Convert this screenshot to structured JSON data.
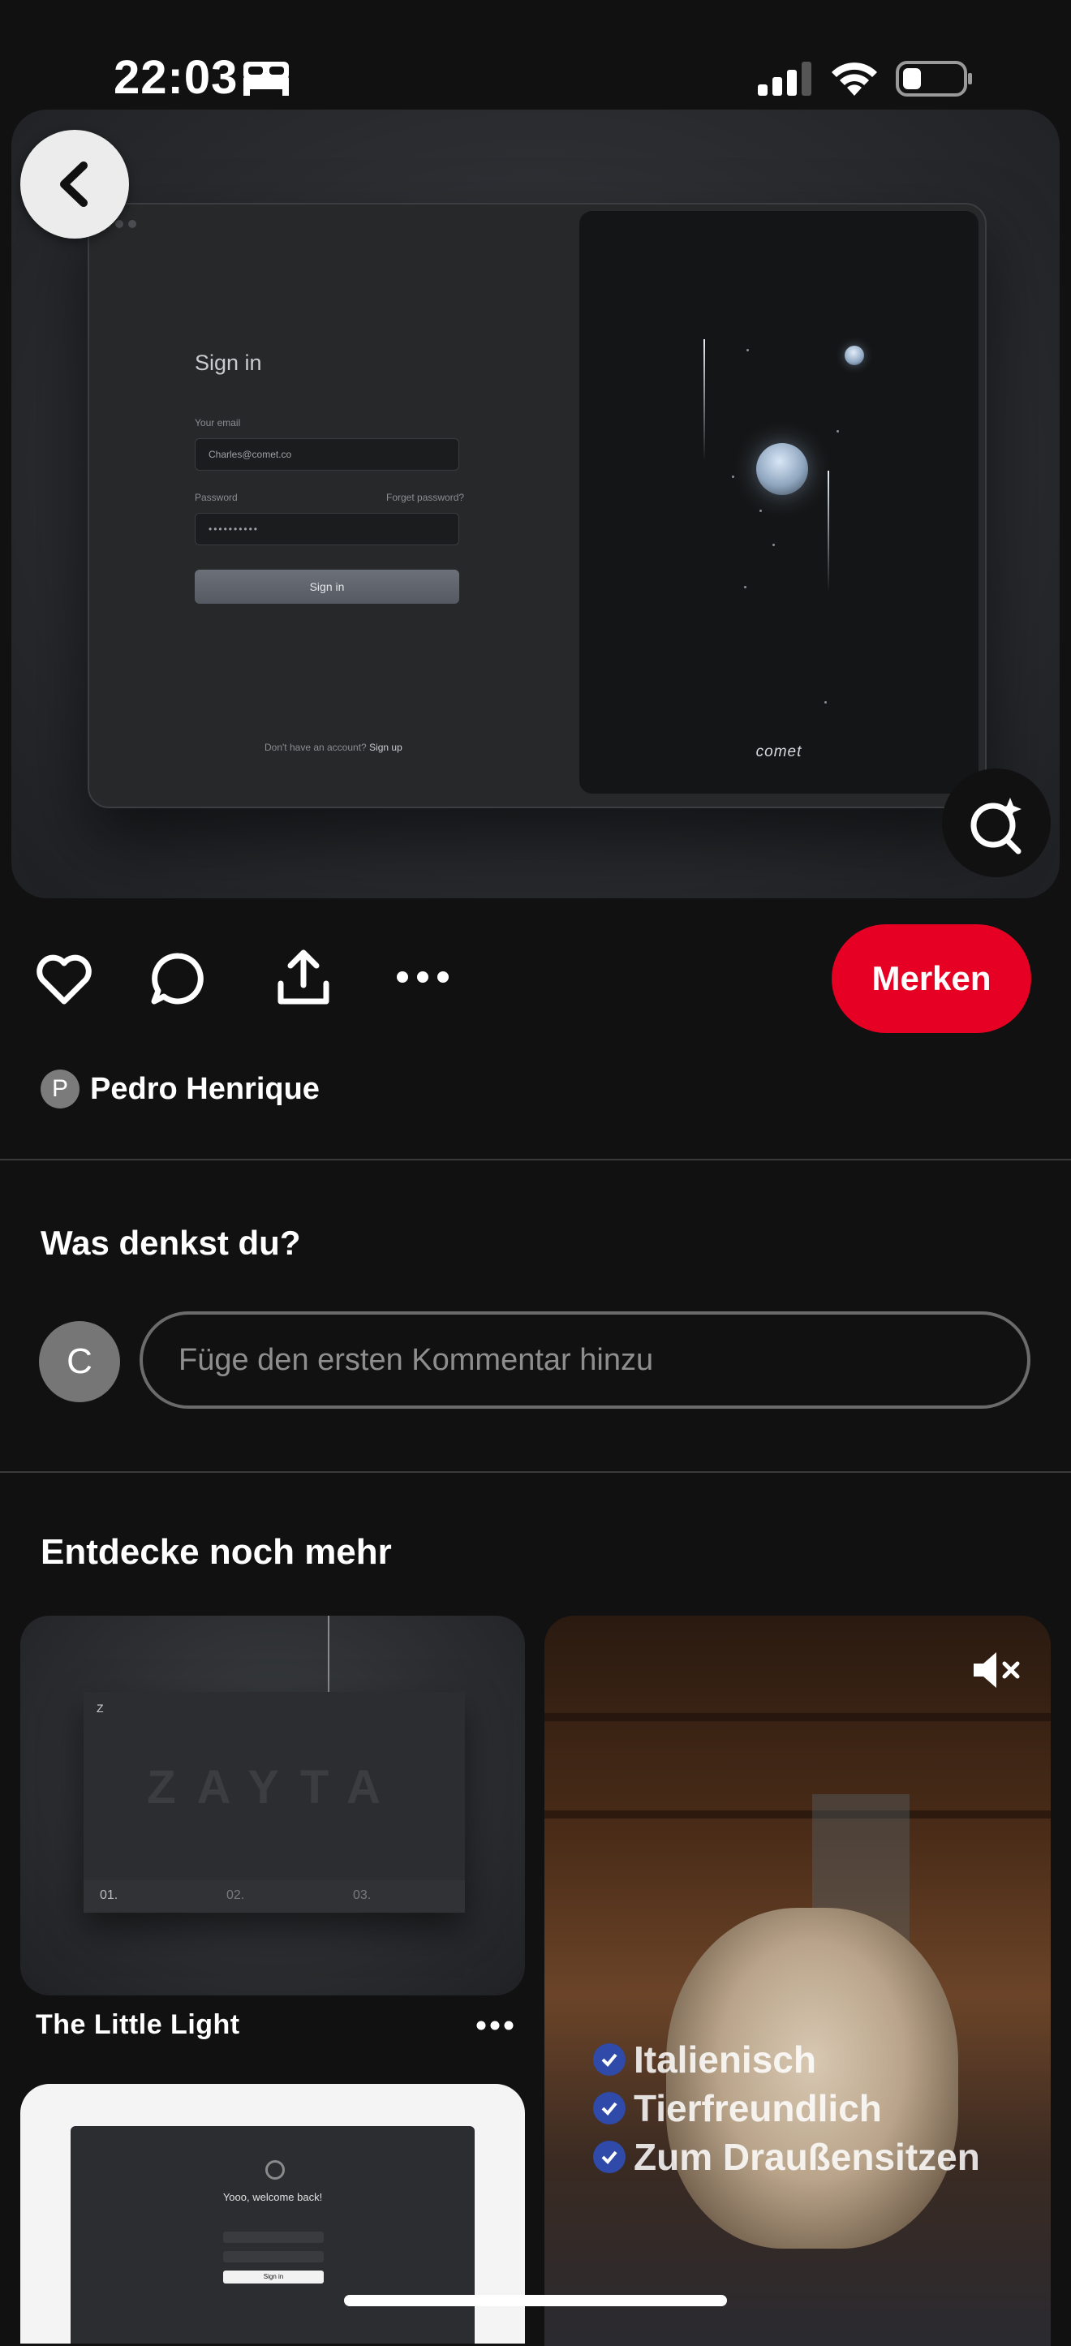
{
  "status_bar": {
    "time": "22:03"
  },
  "hero": {
    "mockup": {
      "title": "Sign in",
      "email_label": "Your email",
      "email_value": "Charles@comet.co",
      "password_label": "Password",
      "forgot_label": "Forget password?",
      "password_value": "••••••••••",
      "signin_button": "Sign in",
      "footer_text": "Don't have an account?",
      "footer_link": "Sign up",
      "brand": "comet"
    }
  },
  "actions": {
    "save_label": "Merken"
  },
  "author": {
    "initial": "P",
    "name": "Pedro Henrique"
  },
  "comments": {
    "heading": "Was denkst du?",
    "user_initial": "C",
    "placeholder": "Füge den ersten Kommentar hinzu"
  },
  "more": {
    "heading": "Entdecke noch mehr",
    "card1": {
      "title": "The Little Light",
      "mock_logo": "Z",
      "mock_word": "ZAYTA",
      "steps": [
        "01.",
        "02.",
        "03."
      ]
    },
    "card2": {
      "features": [
        "Italienisch",
        "Tierfreundlich",
        "Zum Draußensitzen"
      ]
    },
    "card3": {
      "mock_heading": "Yooo, welcome back!",
      "mock_button": "Sign in"
    }
  }
}
